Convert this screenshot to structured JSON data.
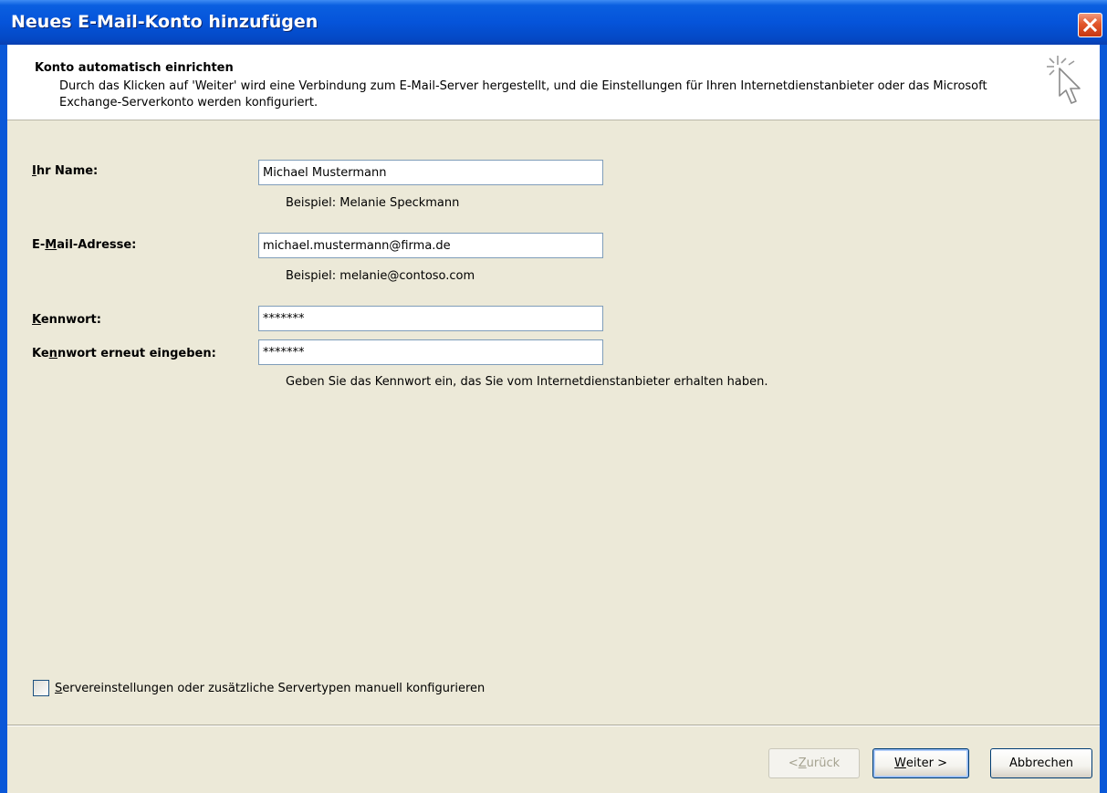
{
  "window": {
    "title": "Neues E-Mail-Konto hinzufügen"
  },
  "header": {
    "title": "Konto automatisch einrichten",
    "description": "Durch das Klicken auf 'Weiter' wird eine Verbindung zum E-Mail-Server hergestellt, und die Einstellungen für Ihren Internetdienstanbieter oder das Microsoft Exchange-Serverkonto werden konfiguriert.",
    "icon": "wizard-cursor-icon"
  },
  "form": {
    "name": {
      "label_pre": "",
      "label_key": "I",
      "label_post": "hr Name:",
      "value": "Michael Mustermann",
      "hint": "Beispiel: Melanie Speckmann"
    },
    "email": {
      "label_pre": "E-",
      "label_key": "M",
      "label_post": "ail-Adresse:",
      "value": "michael.mustermann@firma.de",
      "hint": "Beispiel: melanie@contoso.com"
    },
    "password": {
      "label_pre": "",
      "label_key": "K",
      "label_post": "ennwort:",
      "value": "*******"
    },
    "password_confirm": {
      "label_pre": "Ke",
      "label_key": "n",
      "label_post": "nwort erneut eingeben:",
      "value": "*******"
    },
    "password_hint": "Geben Sie das Kennwort ein, das Sie vom Internetdienstanbieter erhalten haben."
  },
  "manual_config": {
    "label_pre": "",
    "label_key": "S",
    "label_post": "ervereinstellungen oder zusätzliche Servertypen manuell konfigurieren",
    "checked": false
  },
  "buttons": {
    "back": {
      "pre": "< ",
      "key": "Z",
      "post": "urück",
      "enabled": false
    },
    "next": {
      "pre": "",
      "key": "W",
      "post": "eiter >"
    },
    "cancel": {
      "label": "Abbrechen"
    }
  },
  "colors": {
    "titlebar": "#0554da",
    "dialog_bg": "#ece9d8",
    "close_button": "#e2572b"
  }
}
